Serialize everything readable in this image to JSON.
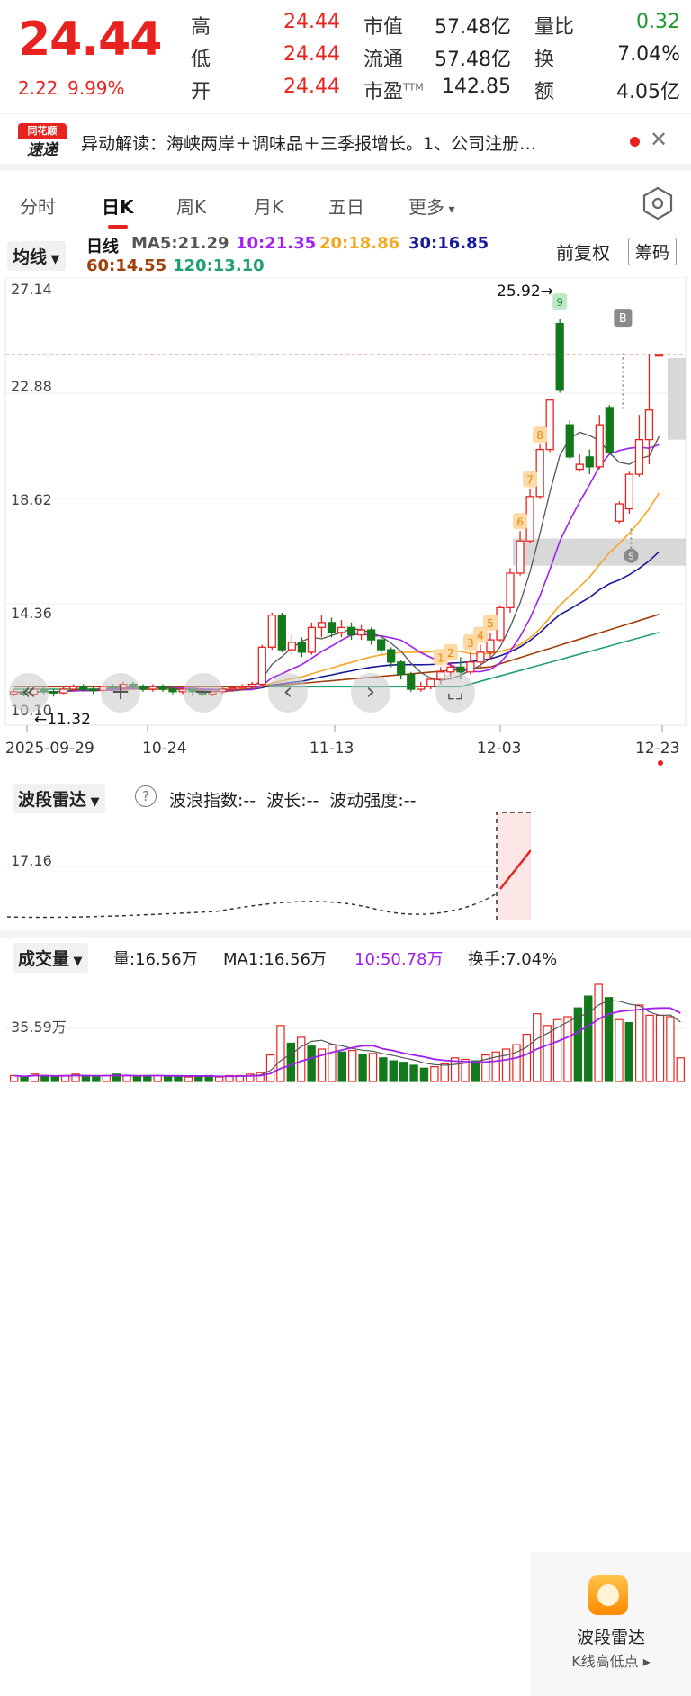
{
  "quote": {
    "price": "24.44",
    "change": "2.22",
    "change_pct": "9.99%",
    "rows": [
      {
        "l1": "高",
        "v1": "24.44",
        "l2": "市值",
        "v2": "57.48亿",
        "l3": "量比",
        "v3": "0.32"
      },
      {
        "l1": "低",
        "v1": "24.44",
        "l2": "流通",
        "v2": "57.48亿",
        "l3": "换",
        "v3": "7.04%"
      },
      {
        "l1": "开",
        "v1": "24.44",
        "l2": "市盈",
        "v2": "142.85",
        "l3": "额",
        "v3": "4.05亿",
        "sup": "TTM"
      }
    ]
  },
  "news": {
    "logo_top": "同花顺",
    "logo_bottom": "速递",
    "text": "异动解读：海峡两岸＋调味品＋三季报增长。1、公司注册…"
  },
  "tabs": [
    "分时",
    "日K",
    "周K",
    "月K",
    "五日",
    "更多"
  ],
  "ma_bar": {
    "indicator": "均线",
    "period": "日线",
    "ma5": "MA5:21.29",
    "ma10": "10:21.35",
    "ma20": "20:18.86",
    "ma30": "30:16.85",
    "ma60": "60:14.55",
    "ma120": "120:13.10",
    "adjust": "前复权",
    "chips": "筹码"
  },
  "chart": {
    "y_labels": [
      "27.14",
      "22.88",
      "18.62",
      "14.36",
      "10.10"
    ],
    "x_labels": [
      "2025-09-29",
      "10-24",
      "11-13",
      "12-03",
      "12-23"
    ],
    "high_label": "25.92→",
    "low_label": "←11.32",
    "signal_b": "B",
    "signal_s": "S",
    "wave_numbers": [
      "1",
      "2",
      "3",
      "4",
      "5",
      "6",
      "7",
      "8",
      "9"
    ],
    "colors": {
      "up": "#e8231f",
      "down": "#137a1c",
      "ma5": "#555555",
      "ma10": "#a020f0",
      "ma20": "#f5a623",
      "ma30": "#1a1a9a",
      "ma60": "#a0400a",
      "ma120": "#20a070"
    }
  },
  "chart_data": {
    "type": "candlestick",
    "dates_start": "2025-09-29",
    "dates_end": "12-23",
    "candles": [
      [
        10.7,
        10.8,
        10.6,
        10.9
      ],
      [
        10.8,
        10.7,
        10.6,
        10.9
      ],
      [
        10.7,
        10.9,
        10.6,
        11.0
      ],
      [
        10.9,
        10.8,
        10.7,
        11.0
      ],
      [
        10.8,
        10.75,
        10.6,
        10.9
      ],
      [
        10.75,
        10.9,
        10.7,
        11.0
      ],
      [
        10.9,
        11.0,
        10.8,
        11.1
      ],
      [
        11.0,
        10.9,
        10.8,
        11.1
      ],
      [
        10.9,
        10.85,
        10.7,
        11.0
      ],
      [
        10.85,
        11.0,
        10.8,
        11.1
      ],
      [
        11.0,
        10.95,
        10.9,
        11.1
      ],
      [
        10.95,
        11.1,
        10.9,
        11.2
      ],
      [
        11.1,
        11.0,
        10.9,
        11.2
      ],
      [
        11.0,
        10.9,
        10.8,
        11.1
      ],
      [
        10.9,
        11.0,
        10.8,
        11.1
      ],
      [
        11.0,
        10.9,
        10.8,
        11.1
      ],
      [
        10.9,
        10.8,
        10.7,
        11.0
      ],
      [
        10.8,
        10.9,
        10.7,
        11.0
      ],
      [
        10.9,
        10.8,
        10.6,
        10.95
      ],
      [
        10.8,
        10.7,
        10.6,
        10.9
      ],
      [
        10.7,
        10.8,
        10.6,
        10.9
      ],
      [
        10.8,
        10.9,
        10.7,
        11.0
      ],
      [
        10.9,
        10.95,
        10.8,
        11.0
      ],
      [
        10.95,
        11.0,
        10.85,
        11.1
      ],
      [
        11.0,
        11.1,
        10.9,
        11.2
      ],
      [
        11.1,
        12.6,
        11.0,
        12.7
      ],
      [
        12.6,
        13.9,
        12.5,
        14.0
      ],
      [
        13.9,
        12.5,
        12.4,
        14.0
      ],
      [
        12.5,
        12.8,
        12.3,
        13.1
      ],
      [
        12.8,
        12.4,
        12.2,
        13.0
      ],
      [
        12.4,
        13.4,
        12.3,
        13.6
      ],
      [
        13.4,
        13.6,
        13.0,
        13.9
      ],
      [
        13.6,
        13.2,
        13.0,
        13.8
      ],
      [
        13.2,
        13.4,
        13.0,
        13.7
      ],
      [
        13.4,
        13.1,
        12.9,
        13.6
      ],
      [
        13.1,
        13.3,
        12.9,
        13.5
      ],
      [
        13.3,
        12.9,
        12.7,
        13.4
      ],
      [
        12.9,
        12.5,
        12.3,
        13.0
      ],
      [
        12.5,
        12.0,
        11.8,
        12.6
      ],
      [
        12.0,
        11.5,
        11.3,
        12.1
      ],
      [
        11.5,
        10.9,
        10.8,
        11.6
      ],
      [
        10.9,
        11.0,
        10.8,
        11.2
      ],
      [
        11.0,
        11.3,
        10.9,
        11.4
      ],
      [
        11.3,
        11.6,
        11.1,
        11.8
      ],
      [
        11.6,
        11.8,
        11.4,
        12.0
      ],
      [
        11.8,
        11.6,
        11.3,
        12.2
      ],
      [
        11.6,
        12.0,
        11.5,
        12.4
      ],
      [
        12.0,
        12.4,
        11.8,
        12.7
      ],
      [
        12.4,
        12.9,
        12.1,
        13.2
      ],
      [
        12.9,
        14.2,
        12.8,
        14.3
      ],
      [
        14.2,
        15.6,
        14.0,
        15.8
      ],
      [
        15.6,
        16.9,
        15.5,
        17.3
      ],
      [
        16.9,
        18.7,
        16.8,
        19.0
      ],
      [
        18.7,
        20.6,
        18.6,
        20.8
      ],
      [
        20.6,
        22.6,
        20.5,
        22.6
      ],
      [
        25.7,
        23.0,
        22.9,
        25.9
      ],
      [
        21.6,
        20.3,
        20.2,
        21.8
      ],
      [
        19.8,
        20.0,
        19.7,
        20.4
      ],
      [
        20.3,
        19.9,
        19.6,
        20.6
      ],
      [
        19.9,
        21.6,
        19.8,
        22.0
      ],
      [
        22.3,
        20.5,
        20.4,
        22.4
      ],
      [
        17.7,
        18.4,
        17.6,
        18.5
      ],
      [
        18.2,
        19.6,
        18.0,
        19.7
      ],
      [
        19.6,
        21.0,
        19.5,
        22.0
      ],
      [
        21.0,
        22.2,
        20.0,
        24.44
      ],
      [
        24.44,
        24.44,
        24.44,
        24.44
      ]
    ],
    "ma_values_latest": {
      "ma5": 21.29,
      "ma10": 21.35,
      "ma20": 18.86,
      "ma30": 16.85,
      "ma60": 14.55,
      "ma120": 13.1
    },
    "ylim": [
      10.1,
      27.14
    ]
  },
  "wave": {
    "label": "波段雷达",
    "fields": "波浪指数:--  波长:--  波动强度:--",
    "y_label": "17.16",
    "popup_title": "波段雷达",
    "popup_sub": "K线高低点"
  },
  "volume": {
    "label": "成交量",
    "vol": "量:16.56万",
    "ma1": "MA1:16.56万",
    "ma10": "10:50.78万",
    "turnover": "换手:7.04%",
    "y_label": "35.59万",
    "bars": [
      4,
      3,
      5,
      4,
      3,
      4,
      5,
      4,
      3,
      4,
      5,
      4,
      3,
      4,
      4,
      3,
      4,
      3,
      3,
      4,
      3,
      4,
      4,
      5,
      6,
      18,
      38,
      26,
      30,
      24,
      22,
      25,
      20,
      21,
      18,
      19,
      16,
      14,
      13,
      11,
      9,
      10,
      12,
      16,
      15,
      14,
      18,
      20,
      22,
      25,
      32,
      46,
      38,
      42,
      44,
      50,
      58,
      66,
      57,
      42,
      40,
      52,
      45,
      45,
      44,
      16
    ]
  }
}
